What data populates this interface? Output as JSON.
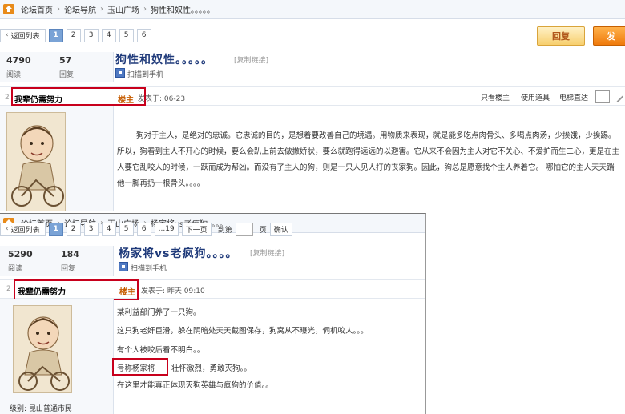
{
  "panel1": {
    "breadcrumb": [
      "论坛首页",
      "论坛导航",
      "玉山广场",
      "狗性和奴性。。。。。"
    ],
    "pager": {
      "back_label": "返回列表",
      "pages": [
        "1",
        "2",
        "3",
        "4",
        "5",
        "6"
      ],
      "active_page": "1"
    },
    "reply_label": "回复",
    "post_label": "发",
    "stats": {
      "views": "4790",
      "views_label": "阅读",
      "replies": "57",
      "replies_label": "回复"
    },
    "title": "狗性和奴性。。。。。",
    "copy_link": "[复制链接]",
    "qr_text": "扫描到手机",
    "post": {
      "user_num": "2",
      "username": "我辈仍需努力",
      "badge": "楼主",
      "time": "发表于: 06-23",
      "tools": [
        "只看楼主",
        "使用道具",
        "电梯直达"
      ],
      "paragraph": "狗对于主人，是绝对的忠诚。它忠诚的目的，是想着要改善自己的境遇。用物质来表现，就是能多吃点肉骨头、多喝点肉汤，少挨饿，少挨踢。所以，狗看到主人不开心的时候，要么会趴上前去做撒娇状，要么就跑得远远的以避害。它从来不会因为主人对它不关心、不爱护而生二心，更是在主人要它乱咬人的时候，一跃而成为帮凶。而没有了主人的狗，则是一只人见人打的丧家狗。因此，狗总是愿意找个主人养着它。 哪怕它的主人天天踹他一脚再扔一根骨头。。。。"
    }
  },
  "panel2": {
    "breadcrumb": [
      "论坛首页",
      "论坛导航",
      "玉山广场",
      "杨家将vs老疯狗。。。。"
    ],
    "pager": {
      "back_label": "返回列表",
      "pages": [
        "1",
        "2",
        "3",
        "4",
        "5",
        "6",
        "...19"
      ],
      "active_page": "1",
      "next_label": "下一页",
      "goto_label": "到第",
      "page_label": "页",
      "confirm_label": "确认"
    },
    "stats": {
      "views": "5290",
      "views_label": "阅读",
      "replies": "184",
      "replies_label": "回复"
    },
    "title": "杨家将vs老疯狗。。。。",
    "copy_link": "[复制链接]",
    "qr_text": "扫描到手机",
    "post": {
      "user_num": "2",
      "username": "我辈仍需努力",
      "badge": "楼主",
      "time": "发表于: 昨天 09:10",
      "level": "级别: 昆山普通市民",
      "lines": [
        "某利益部门养了一只狗。",
        "这只狗老奸巨滑，躲在阴暗处天天截图保存，狗窝从不曝光，伺机咬人。。。",
        "有个人被咬后看不明白。。",
        "号称杨家将",
        "壮怀激烈，勇敢灭狗。。",
        "在这里才能真正体现灭狗英雄与疯狗的价值。。"
      ]
    }
  },
  "colors": {
    "title_blue": "#1f3a7a",
    "annotation_red": "#c8001c",
    "badge_orange": "#c65c00",
    "page_active": "#7aa3d6"
  }
}
